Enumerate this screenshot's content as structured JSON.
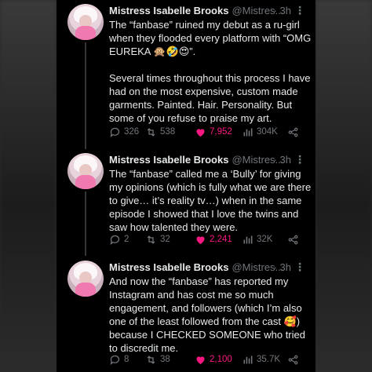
{
  "tweets": [
    {
      "name": "Mistress Isabelle Brooks",
      "handle": "@Mistres...",
      "time": "· 3h",
      "text": "The “fanbase” ruined my debut as a ru-girl when they flooded every platform with “OMG EUREKA 🙊🤣😍”.\n\nSeveral times throughout this process I have had on the most expensive, custom made garments. Painted. Hair. Personality. But some of you refuse to praise my art.",
      "replies": "326",
      "retweets": "538",
      "likes": "7,952",
      "views": "304K"
    },
    {
      "name": "Mistress Isabelle Brooks",
      "handle": "@Mistres...",
      "time": "· 3h",
      "text": "The “fanbase” called me a ‘Bully’ for giving my opinions (which is fully what we are there to give… it’s reality tv…) when in the same episode I showed that I love the twins and saw how talented they were.",
      "replies": "2",
      "retweets": "32",
      "likes": "2,241",
      "views": "32K"
    },
    {
      "name": "Mistress Isabelle Brooks",
      "handle": "@Mistres...",
      "time": "· 3h",
      "text": "And now the “fanbase” has reported my Instagram and has cost me so much engagement, and followers (which I’m also one of the least followed from the cast 🥰) because I CHECKED SOMEONE who tried to discredit me.",
      "replies": "8",
      "retweets": "38",
      "likes": "2,100",
      "views": "35.7K"
    }
  ],
  "colors": {
    "background": "#000000",
    "text": "#e7e9ea",
    "muted": "#71767b",
    "like": "#f91880"
  },
  "icons": [
    "reply-icon",
    "retweet-icon",
    "heart-icon",
    "views-icon",
    "share-icon",
    "more-icon"
  ]
}
